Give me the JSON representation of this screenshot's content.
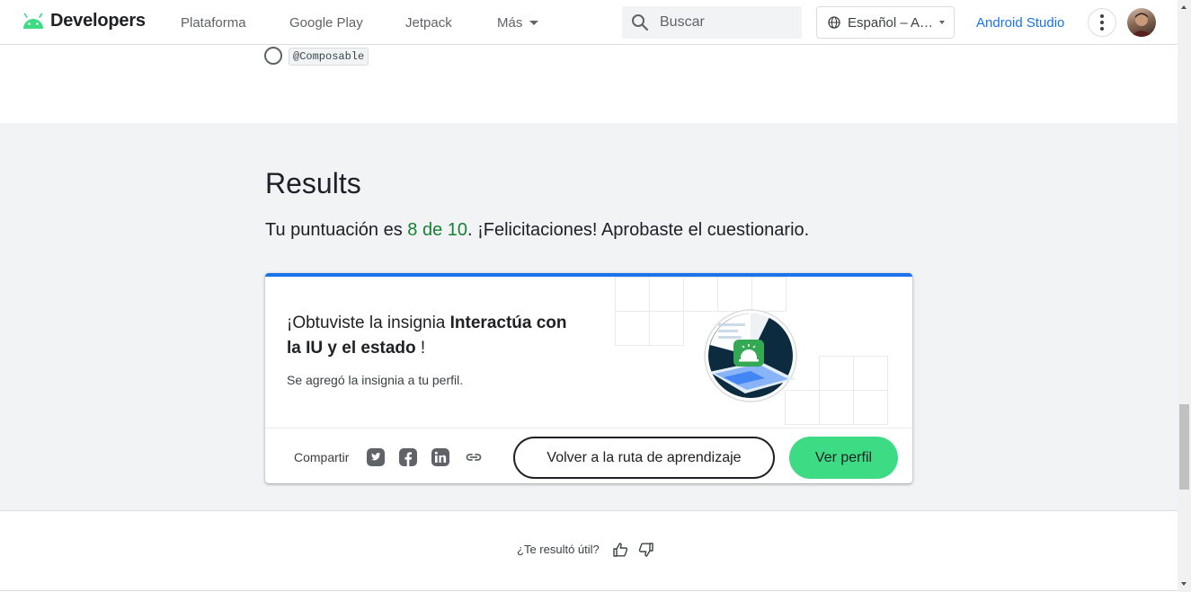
{
  "header": {
    "logo_text": "Developers",
    "nav": [
      "Plataforma",
      "Google Play",
      "Jetpack",
      "Más"
    ],
    "search_placeholder": "Buscar",
    "language": "Español – A…",
    "studio_link": "Android Studio",
    "brand_color": "#3ddc84",
    "link_color": "#1a73e8"
  },
  "quiz_option": {
    "code": "@Composable"
  },
  "results": {
    "title": "Results",
    "score_prefix": "Tu puntuación es ",
    "score_value": "8 de 10",
    "score_suffix": ". ¡Felicitaciones! Aprobaste el cuestionario.",
    "score_color": "#188038"
  },
  "badge": {
    "title_prefix": "¡Obtuviste la insignia ",
    "title_name": "Interactúa con la IU y el estado",
    "title_suffix": " !",
    "subtitle": "Se agregó la insignia a tu perfil.",
    "share_label": "Compartir",
    "share_icons": [
      "twitter-icon",
      "facebook-icon",
      "linkedin-icon",
      "link-icon"
    ],
    "back_button": "Volver a la ruta de aprendizaje",
    "profile_button": "Ver perfil",
    "accent_color": "#1a73e8"
  },
  "feedback": {
    "question": "¿Te resultó útil?"
  }
}
